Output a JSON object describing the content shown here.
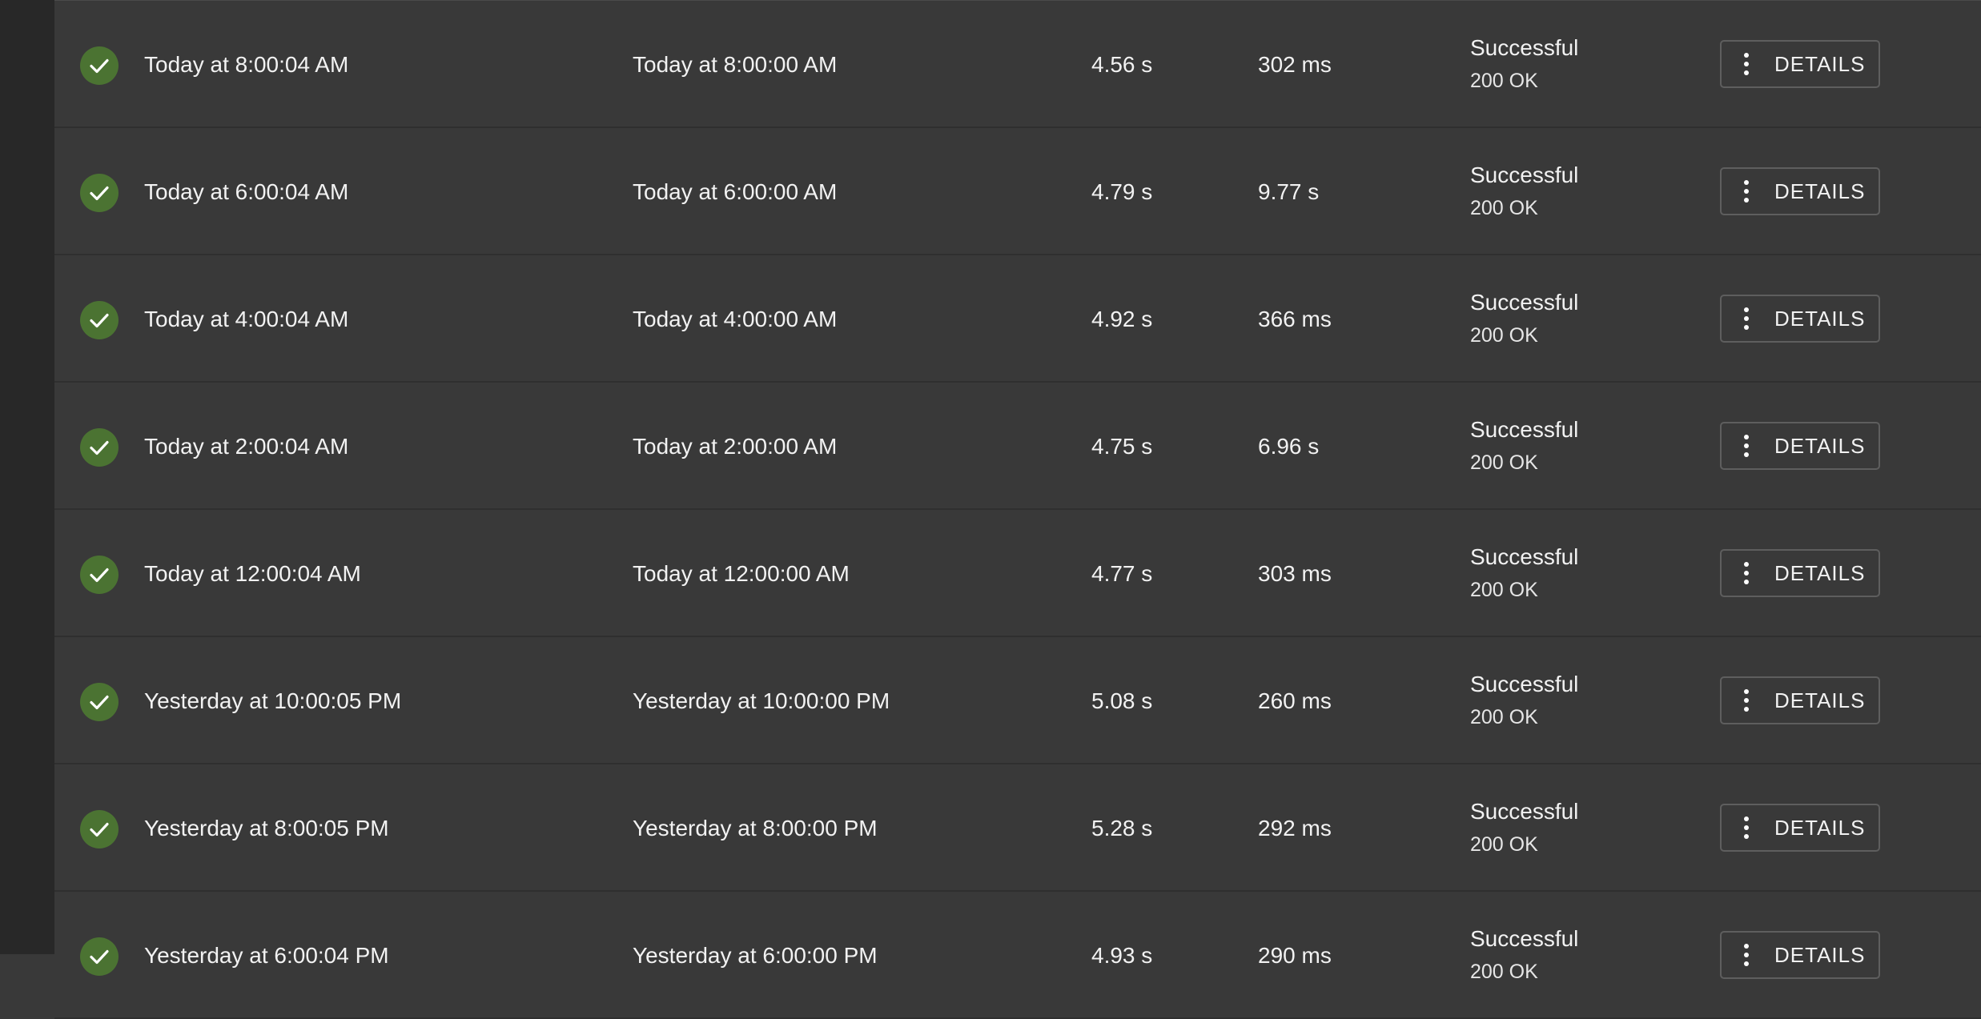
{
  "rows": [
    {
      "completed": "Today at 8:00:04 AM",
      "scheduled": "Today at 8:00:00 AM",
      "duration": "4.56 s",
      "response_time": "302 ms",
      "status": "Successful",
      "code": "200 OK",
      "action": "DETAILS"
    },
    {
      "completed": "Today at 6:00:04 AM",
      "scheduled": "Today at 6:00:00 AM",
      "duration": "4.79 s",
      "response_time": "9.77 s",
      "status": "Successful",
      "code": "200 OK",
      "action": "DETAILS"
    },
    {
      "completed": "Today at 4:00:04 AM",
      "scheduled": "Today at 4:00:00 AM",
      "duration": "4.92 s",
      "response_time": "366 ms",
      "status": "Successful",
      "code": "200 OK",
      "action": "DETAILS"
    },
    {
      "completed": "Today at 2:00:04 AM",
      "scheduled": "Today at 2:00:00 AM",
      "duration": "4.75 s",
      "response_time": "6.96 s",
      "status": "Successful",
      "code": "200 OK",
      "action": "DETAILS"
    },
    {
      "completed": "Today at 12:00:04 AM",
      "scheduled": "Today at 12:00:00 AM",
      "duration": "4.77 s",
      "response_time": "303 ms",
      "status": "Successful",
      "code": "200 OK",
      "action": "DETAILS"
    },
    {
      "completed": "Yesterday at 10:00:05 PM",
      "scheduled": "Yesterday at 10:00:00 PM",
      "duration": "5.08 s",
      "response_time": "260 ms",
      "status": "Successful",
      "code": "200 OK",
      "action": "DETAILS"
    },
    {
      "completed": "Yesterday at 8:00:05 PM",
      "scheduled": "Yesterday at 8:00:00 PM",
      "duration": "5.28 s",
      "response_time": "292 ms",
      "status": "Successful",
      "code": "200 OK",
      "action": "DETAILS"
    },
    {
      "completed": "Yesterday at 6:00:04 PM",
      "scheduled": "Yesterday at 6:00:00 PM",
      "duration": "4.93 s",
      "response_time": "290 ms",
      "status": "Successful",
      "code": "200 OK",
      "action": "DETAILS"
    }
  ],
  "icons": {
    "status": "check-circle-icon",
    "menu": "more-vert-icon"
  },
  "colors": {
    "background": "#393939",
    "sidebar": "#282828",
    "success": "#4b7332",
    "divider": "#2f2f2f",
    "button_border": "#5e5e5e"
  }
}
